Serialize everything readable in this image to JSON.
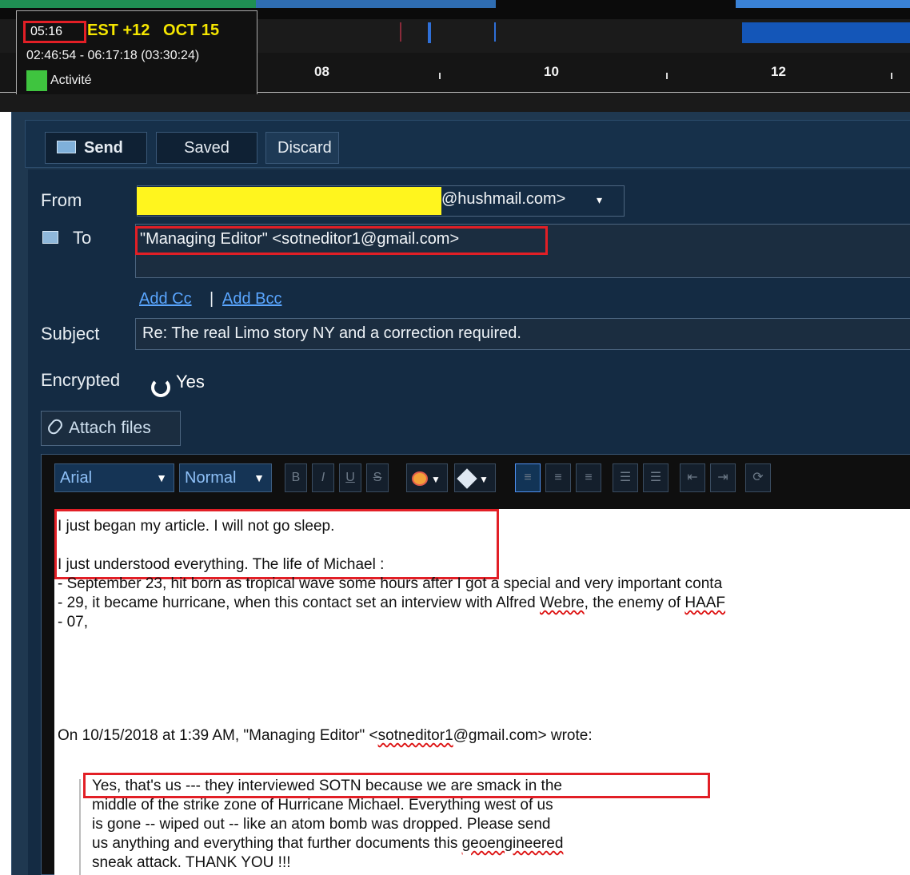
{
  "timeline": {
    "current_time": "05:16",
    "timezone_date": "EST +12   OCT 15",
    "range": "02:46:54 - 06:17:18 (03:30:24)",
    "legend_label": "Activité",
    "legend_color": "#3fc43f",
    "hours": [
      "08",
      "10",
      "12"
    ]
  },
  "toolbar": {
    "send_label": "Send",
    "saved_label": "Saved",
    "discard_label": "Discard"
  },
  "form": {
    "from_label": "From",
    "from_domain": "@hushmail.com>",
    "from_dropdown": "▾",
    "to_label": "To",
    "to_value": "\"Managing Editor\" <sotneditor1@gmail.com>",
    "add_cc": "Add Cc",
    "cc_separator": "|",
    "add_bcc": "Add Bcc",
    "subject_label": "Subject",
    "subject_value": "Re: The real Limo story NY and a correction required.",
    "encrypted_label": "Encrypted",
    "encrypted_value": "Yes",
    "attach_label": "Attach files"
  },
  "editor_toolbar": {
    "font": "Arial",
    "size": "Normal"
  },
  "body": {
    "line1": "I just began my article. I will not go sleep.",
    "line2": "I just understood everything. The life of Michael :",
    "line3": "- September 23, hit born as tropical wave some hours after I got a special and very important conta",
    "line4a": "- 29, it became hurricane, when this contact set an interview with Alfred ",
    "line4b": "Webre",
    "line4c": ", the enemy of ",
    "line4d": "HAAF",
    "line5": "- 07,",
    "quote_header_a": "On 10/15/2018 at 1:39 AM, \"Managing Editor\" <",
    "quote_header_b": "sotneditor1",
    "quote_header_c": "@gmail.com> wrote:",
    "quote1": "Yes, that's us --- they interviewed SOTN because we are smack in the",
    "quote2": "middle of the strike zone of Hurricane Michael.  Everything west of us",
    "quote3": "is gone -- wiped out -- like an atom bomb was dropped.  Please send",
    "quote4a": "us anything and everything that further documents this ",
    "quote4b": "geoengineered",
    "quote5": "sneak attack.  THANK YOU !!!"
  }
}
